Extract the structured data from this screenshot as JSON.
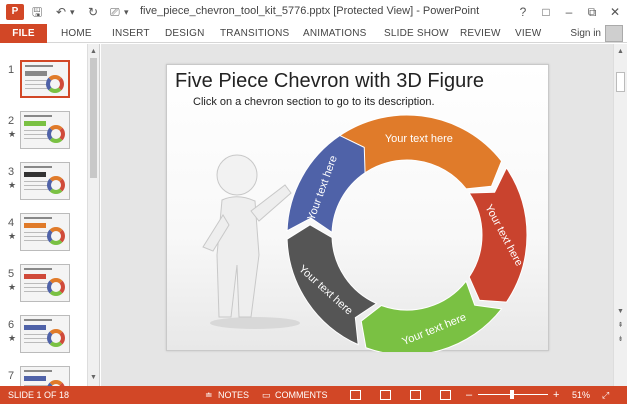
{
  "window": {
    "title": "five_piece_chevron_tool_kit_5776.pptx [Protected View] - PowerPoint",
    "app_icon": "P",
    "controls": [
      "?",
      "□",
      "–",
      "⧉",
      "✕"
    ]
  },
  "quick_access": {
    "save_icon": "save-icon",
    "undo_icon": "undo-icon",
    "redo_icon": "redo-icon",
    "present_icon": "present-icon"
  },
  "ribbon": {
    "tabs": [
      "FILE",
      "HOME",
      "INSERT",
      "DESIGN",
      "TRANSITIONS",
      "ANIMATIONS",
      "SLIDE SHOW",
      "REVIEW",
      "VIEW"
    ],
    "sign_in": "Sign in"
  },
  "thumbnails": [
    {
      "num": "1",
      "star": "",
      "bar_color": "#888888"
    },
    {
      "num": "2",
      "star": "★",
      "bar_color": "#7ac143"
    },
    {
      "num": "3",
      "star": "★",
      "bar_color": "#333333"
    },
    {
      "num": "4",
      "star": "★",
      "bar_color": "#e07b2a"
    },
    {
      "num": "5",
      "star": "★",
      "bar_color": "#d04a3a"
    },
    {
      "num": "6",
      "star": "★",
      "bar_color": "#4f62a8"
    },
    {
      "num": "7",
      "star": "",
      "bar_color": "#4f62a8"
    }
  ],
  "slide": {
    "title": "Five Piece Chevron with 3D Figure",
    "subtitle": "Click on a chevron section to go to its description.",
    "segments": [
      {
        "label": "Your text here",
        "color": "#e07b2a"
      },
      {
        "label": "Your text here",
        "color": "#c9432e"
      },
      {
        "label": "Your text here",
        "color": "#7ac143"
      },
      {
        "label": "Your text here",
        "color": "#555555"
      },
      {
        "label": "Your text here",
        "color": "#4f62a8"
      }
    ]
  },
  "status": {
    "slide_info": "SLIDE 1 OF 18",
    "notes": "NOTES",
    "comments": "COMMENTS",
    "zoom": "51%",
    "zoom_level": 0.51,
    "zoom_minus": "–",
    "zoom_plus": "+"
  },
  "colors": {
    "accent": "#d24726"
  }
}
